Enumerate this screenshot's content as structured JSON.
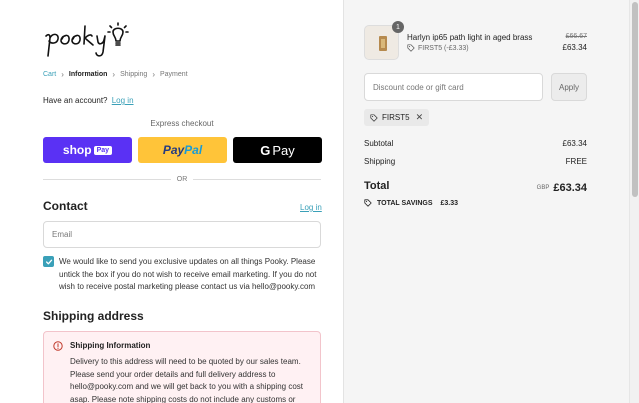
{
  "brand": {
    "logo_text": "pooky"
  },
  "breadcrumb": {
    "cart": "Cart",
    "information": "Information",
    "shipping": "Shipping",
    "payment": "Payment"
  },
  "account": {
    "prompt": "Have an account?",
    "login": "Log in"
  },
  "express": {
    "label": "Express checkout",
    "shop_pay": {
      "word": "shop",
      "badge": "Pay"
    },
    "paypal": {
      "part1": "Pay",
      "part2": "Pal"
    },
    "gpay": {
      "g": "G",
      "pay": "Pay"
    }
  },
  "divider": {
    "or": "OR"
  },
  "contact": {
    "title": "Contact",
    "login": "Log in",
    "email_placeholder": "Email",
    "consent_text": "We would like to send you exclusive updates on all things Pooky. Please untick the box if you do not wish to receive email marketing. If you do not wish to receive postal marketing please contact us via hello@pooky.com",
    "consent_checked": true
  },
  "shipping_address": {
    "title": "Shipping address",
    "alert": {
      "title": "Shipping Information",
      "body": "Delivery to this address will need to be quoted by our sales team. Please send your order details and full delivery address to hello@pooky.com and we will get back to you with a shipping cost asap. Please note shipping costs do not include any customs or duty"
    }
  },
  "order": {
    "item": {
      "quantity": "1",
      "name": "Harlyn ip65 path light in aged brass",
      "discount": "FIRST5 (-£3.33)",
      "original_price": "£66.67",
      "price": "£63.34"
    },
    "discount_placeholder": "Discount code or gift card",
    "apply_label": "Apply",
    "applied_code": "FIRST5",
    "subtotal_label": "Subtotal",
    "subtotal_value": "£63.34",
    "shipping_label": "Shipping",
    "shipping_value": "FREE",
    "total_label": "Total",
    "total_currency": "GBP",
    "total_value": "£63.34",
    "savings_label": "TOTAL SAVINGS",
    "savings_value": "£3.33"
  },
  "colors": {
    "accent": "#3aa0b8",
    "shop_pay": "#5a31f4",
    "paypal": "#ffc439",
    "gpay": "#000000",
    "alert_bg": "#fff1f3"
  }
}
